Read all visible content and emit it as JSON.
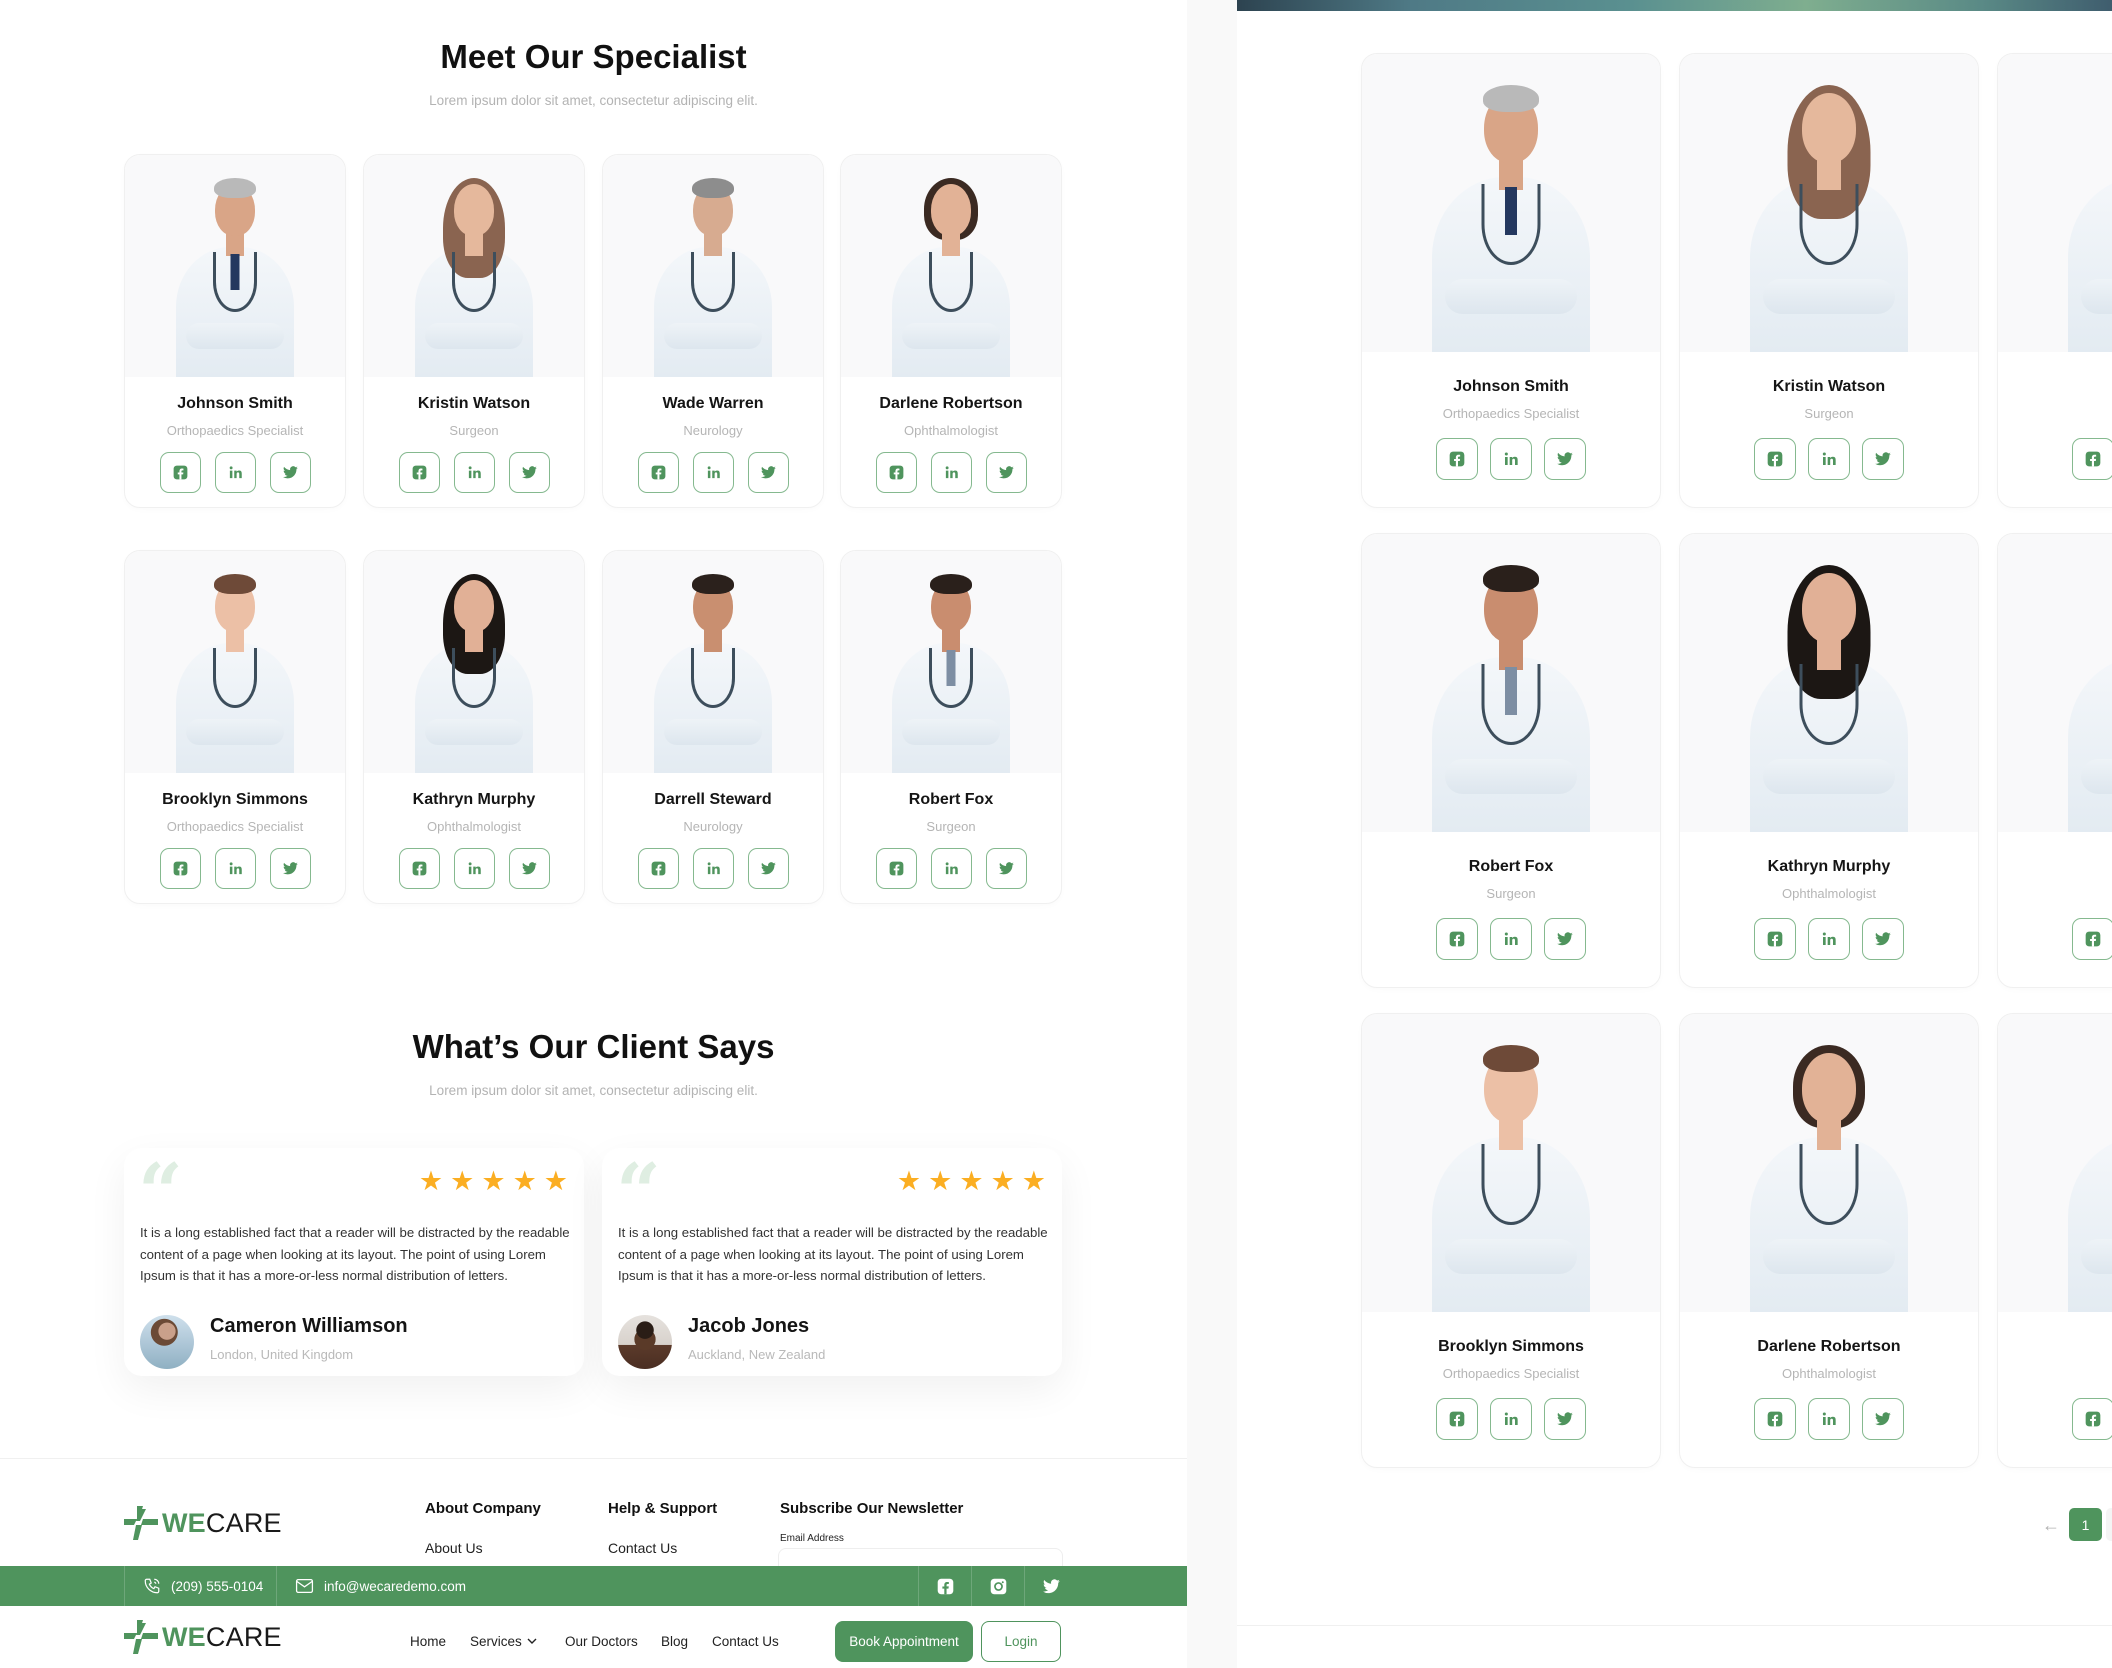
{
  "specialists": {
    "title": "Meet Our Specialist",
    "subtitle": "Lorem ipsum dolor sit amet, consectetur adipiscing elit.",
    "doctors": [
      {
        "name": "Johnson Smith",
        "role": "Orthopaedics Specialist",
        "look": "m-gray"
      },
      {
        "name": "Kristin Watson",
        "role": "Surgeon",
        "look": "f-long-light"
      },
      {
        "name": "Wade Warren",
        "role": "Neurology",
        "look": "m-gray-glasses"
      },
      {
        "name": "Darlene Robertson",
        "role": "Ophthalmologist",
        "look": "f-bob"
      },
      {
        "name": "Brooklyn Simmons",
        "role": "Orthopaedics Specialist",
        "look": "f-updo"
      },
      {
        "name": "Kathryn Murphy",
        "role": "Ophthalmologist",
        "look": "f-long-dark"
      },
      {
        "name": "Darrell Steward",
        "role": "Neurology",
        "look": "m-dark"
      },
      {
        "name": "Robert Fox",
        "role": "Surgeon",
        "look": "m-dark-tablet"
      }
    ],
    "social_icons": [
      "facebook-icon",
      "linkedin-icon",
      "twitter-icon"
    ]
  },
  "testimonials": {
    "title": "What’s Our Client Says",
    "subtitle": "Lorem ipsum dolor sit amet, consectetur adipiscing elit.",
    "items": [
      {
        "rating": 5,
        "text": "It is a long established fact that a reader will be distracted by the readable content of a page when looking at its layout. The point of using Lorem Ipsum is that it has a more-or-less normal distribution of letters.",
        "name": "Cameron Williamson",
        "location": "London, United Kingdom"
      },
      {
        "rating": 5,
        "text": "It is a long established fact that a reader will be distracted by the readable content of a page when looking at its layout. The point of using Lorem Ipsum is that it has a more-or-less normal distribution of letters.",
        "name": "Jacob Jones",
        "location": "Auckland, New Zealand"
      }
    ]
  },
  "footer": {
    "logo_we": "WE",
    "logo_care": "CARE",
    "col1_title": "About Company",
    "col1_link": "About Us",
    "col2_title": "Help & Support",
    "col2_link": "Contact Us",
    "col3_title": "Subscribe Our Newsletter",
    "email_label": "Email Address"
  },
  "topbar": {
    "phone": "(209) 555-0104",
    "email": "info@wecaredemo.com"
  },
  "navbar": {
    "logo_we": "WE",
    "logo_care": "CARE",
    "items": [
      "Home",
      "Services",
      "Our Doctors",
      "Blog",
      "Contact Us"
    ],
    "book_label": "Book Appointment",
    "login_label": "Login"
  },
  "doctors_page": {
    "grid": [
      {
        "name": "Johnson Smith",
        "role": "Orthopaedics Specialist",
        "look": "m-gray"
      },
      {
        "name": "Kristin Watson",
        "role": "Surgeon",
        "look": "f-long-light"
      },
      {
        "name": "W",
        "role": "",
        "look": "m-gray-glasses"
      },
      {
        "name": "Robert Fox",
        "role": "Surgeon",
        "look": "m-dark-tablet"
      },
      {
        "name": "Kathryn Murphy",
        "role": "Ophthalmologist",
        "look": "f-long-dark"
      },
      {
        "name": "Da",
        "role": "",
        "look": "m-dark"
      },
      {
        "name": "Brooklyn Simmons",
        "role": "Orthopaedics Specialist",
        "look": "f-updo"
      },
      {
        "name": "Darlene Robertson",
        "role": "Ophthalmologist",
        "look": "f-bob"
      },
      {
        "name": "J",
        "role": "De",
        "look": "m-dark"
      }
    ],
    "pagination": {
      "prev": "←",
      "current": "1"
    }
  },
  "colors": {
    "brand_green": "#4f945d",
    "star": "#fbae22",
    "muted": "#b5b5b5"
  }
}
